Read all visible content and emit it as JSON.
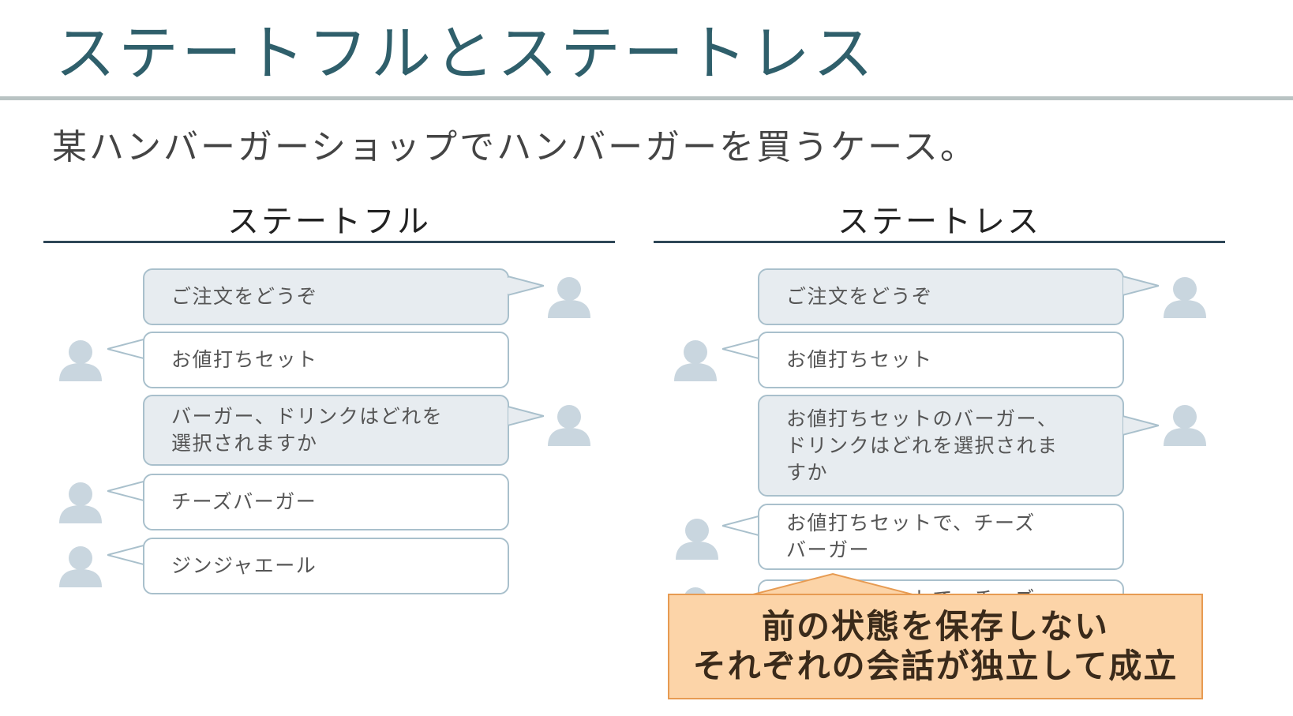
{
  "slide": {
    "title": "ステートフルとステートレス",
    "subtitle": "某ハンバーガーショップでハンバーガーを買うケース。"
  },
  "stateful": {
    "heading": "ステートフル",
    "messages": [
      {
        "speaker": "staff",
        "lines": [
          "ご注文をどうぞ"
        ]
      },
      {
        "speaker": "customer",
        "lines": [
          "お値打ちセット"
        ]
      },
      {
        "speaker": "staff",
        "lines": [
          "バーガー、ドリンクはどれを",
          "選択されますか"
        ]
      },
      {
        "speaker": "customer",
        "lines": [
          "チーズバーガー"
        ]
      },
      {
        "speaker": "customer",
        "lines": [
          "ジンジャエール"
        ]
      }
    ]
  },
  "stateless": {
    "heading": "ステートレス",
    "messages": [
      {
        "speaker": "staff",
        "lines": [
          "ご注文をどうぞ"
        ]
      },
      {
        "speaker": "customer",
        "lines": [
          "お値打ちセット"
        ]
      },
      {
        "speaker": "staff",
        "lines": [
          "お値打ちセットのバーガー、",
          "ドリンクはどれを選択されま",
          "すか"
        ]
      },
      {
        "speaker": "customer",
        "lines": [
          "お値打ちセットで、チーズ",
          "バーガー"
        ]
      },
      {
        "speaker": "customer",
        "lines": [
          "お値打ちセットで、チーズ"
        ]
      }
    ]
  },
  "callout": {
    "lines": [
      "前の状態を保存しない",
      "それぞれの会話が独立して成立"
    ]
  },
  "icons": {
    "person": "person-icon"
  },
  "colors": {
    "title": "#2f5f6b",
    "bubble_staff": "#e7ecf0",
    "bubble_border": "#a9c0cc",
    "avatar": "#c9d6df",
    "callout_fill": "#fcd4a8",
    "callout_border": "#e79b52"
  }
}
